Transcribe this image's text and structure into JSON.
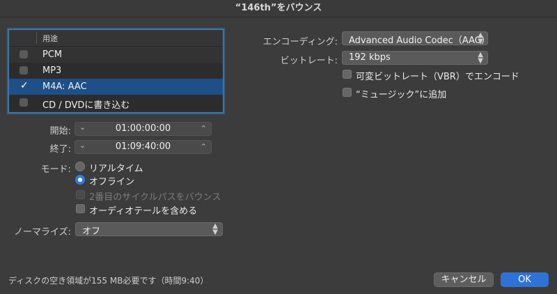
{
  "window": {
    "title": "“146th”をバウンス"
  },
  "format_table": {
    "header": "用途",
    "rows": [
      {
        "label": "PCM",
        "checked": false
      },
      {
        "label": "MP3",
        "checked": false
      },
      {
        "label": "M4A: AAC",
        "checked": true
      },
      {
        "label": "CD / DVDに書き込む",
        "checked": false
      }
    ],
    "checkmark": "✓"
  },
  "start": {
    "label": "開始:",
    "value": "01:00:00:00"
  },
  "end": {
    "label": "終了:",
    "value": "01:09:40:00"
  },
  "stepper_glyphs": {
    "down": "⌄",
    "up": "⌃"
  },
  "mode": {
    "label": "モード:",
    "realtime": "リアルタイム",
    "offline": "オフライン",
    "selected": "offline",
    "second_cycle": "2番目のサイクルパスをバウンス",
    "include_tail": "オーディオテールを含める"
  },
  "normalize": {
    "label": "ノーマライズ:",
    "value": "オフ"
  },
  "encoding": {
    "label": "エンコーディング:",
    "value": "Advanced Audio Codec（AAC）"
  },
  "bitrate": {
    "label": "ビットレート:",
    "value": "192 kbps"
  },
  "options": {
    "vbr": "可変ビットレート（VBR）でエンコード",
    "add_to_music": "“ミュージック”に追加"
  },
  "footer": {
    "disk_space": "ディスクの空き領域が155 MB必要です（時間9:40）",
    "cancel": "キャンセル",
    "ok": "OK"
  },
  "colors": {
    "accent": "#2f72d6",
    "selection": "#1e4f86",
    "background": "#3c3c3c"
  }
}
